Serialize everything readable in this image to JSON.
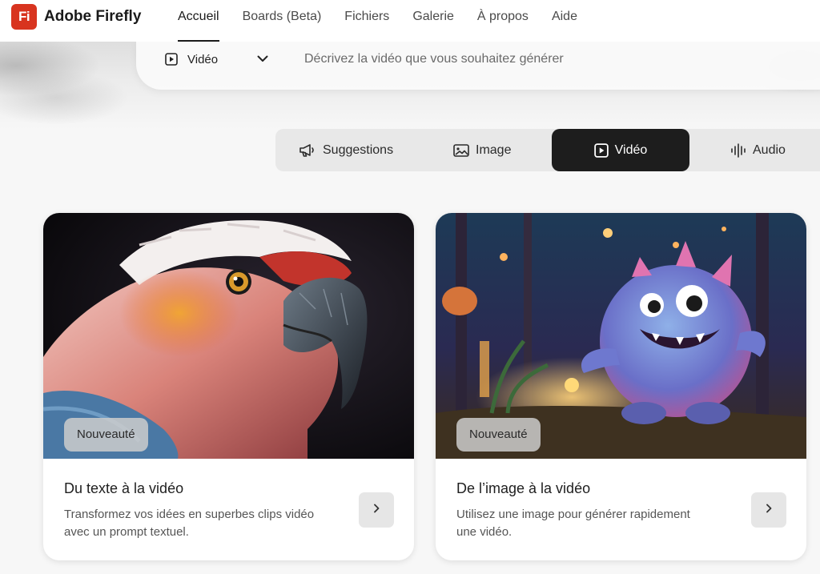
{
  "brand": {
    "logo_text": "Fi",
    "name": "Adobe Firefly",
    "color": "#d8341f"
  },
  "nav": {
    "items": [
      {
        "label": "Accueil",
        "active": true
      },
      {
        "label": "Boards (Beta)"
      },
      {
        "label": "Fichiers"
      },
      {
        "label": "Galerie"
      },
      {
        "label": "À propos"
      },
      {
        "label": "Aide"
      }
    ]
  },
  "prompt": {
    "media_type": "Vidéo",
    "media_icon": "play-square-icon",
    "placeholder": "Décrivez la vidéo que vous souhaitez générer"
  },
  "tabs": [
    {
      "label": "Suggestions",
      "icon": "megaphone-icon"
    },
    {
      "label": "Image",
      "icon": "image-icon"
    },
    {
      "label": "Vidéo",
      "icon": "play-square-icon",
      "active": true
    },
    {
      "label": "Audio",
      "icon": "waveform-icon"
    }
  ],
  "cards": [
    {
      "badge": "Nouveauté",
      "title": "Du texte à la vidéo",
      "description": "Transformez vos idées en superbes clips vidéo avec un prompt textuel.",
      "image": "parrot-illustration",
      "action_icon": "chevron-right-icon"
    },
    {
      "badge": "Nouveauté",
      "title": "De l’image à la vidéo",
      "description": "Utilisez une image pour générer rapidement une vidéo.",
      "image": "monster-illustration",
      "action_icon": "chevron-right-icon"
    }
  ],
  "colors": {
    "active_tab": "#1d1d1d",
    "tab_bar": "#e8e8e8",
    "card_action": "#e6e6e6"
  }
}
